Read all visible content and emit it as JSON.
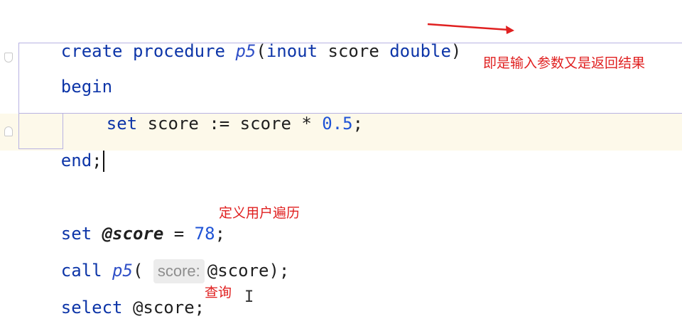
{
  "code": {
    "line1": {
      "kw_create": "create",
      "kw_procedure": "procedure",
      "proc_name": "p5",
      "paren_open": "(",
      "kw_inout": "inout",
      "param": "score",
      "kw_double": "double",
      "paren_close": ")"
    },
    "line2": {
      "kw_begin": "begin"
    },
    "line3": {
      "kw_set": "set",
      "var1": "score",
      "op_assign": ":=",
      "var2": "score",
      "op_mul": "*",
      "num": "0.5",
      "semi": ";"
    },
    "line4": {
      "kw_end": "end",
      "semi": ";"
    },
    "line5": {
      "kw_set": "set",
      "uvar": "@score",
      "op_eq": "=",
      "num": "78",
      "semi": ";"
    },
    "line6": {
      "kw_call": "call",
      "proc_name": "p5",
      "paren_open": "(",
      "hint": "score:",
      "arg": "@score",
      "close": ");"
    },
    "line7": {
      "kw_select": "select",
      "uvar": "@score",
      "semi": ";"
    }
  },
  "annotations": {
    "inout_note": "即是输入参数又是返回结果",
    "set_note": "定义用户遍历",
    "select_note": "查询"
  },
  "colors": {
    "keyword": "#0d35a8",
    "function": "#2f4fc7",
    "number": "#1f53d6",
    "annotation": "#e02020",
    "caret_line": "#fdf9ea",
    "block_border": "#b8b2e2"
  },
  "icons": {
    "fold_open": "fold-open-icon",
    "fold_close": "fold-close-icon",
    "text_cursor": "i-beam-cursor-icon",
    "arrow": "red-arrow-icon"
  }
}
